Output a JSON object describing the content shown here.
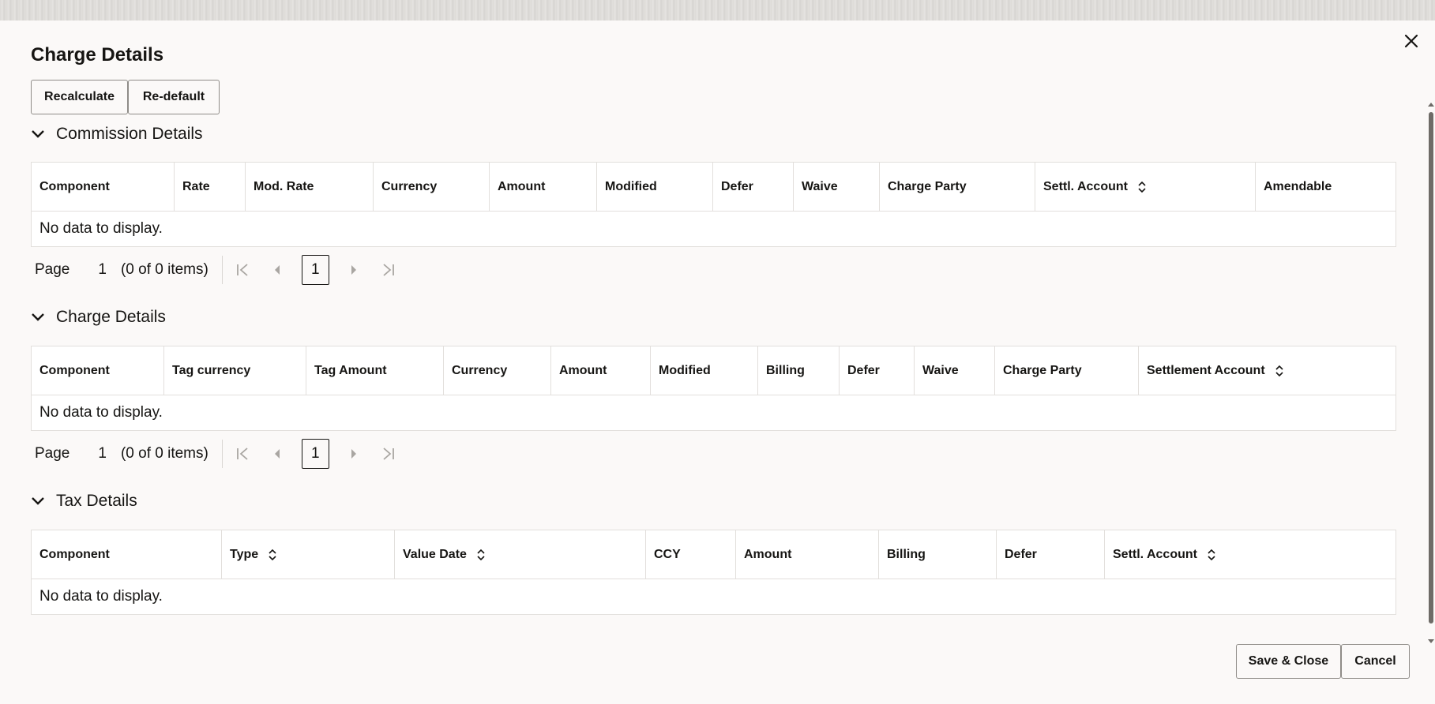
{
  "dialog": {
    "title": "Charge Details",
    "close_icon": "close-icon"
  },
  "toolbar": {
    "recalculate_label": "Recalculate",
    "redefault_label": "Re-default"
  },
  "commission": {
    "title": "Commission Details",
    "columns": [
      "Component",
      "Rate",
      "Mod. Rate",
      "Currency",
      "Amount",
      "Modified",
      "Defer",
      "Waive",
      "Charge Party",
      "Settl. Account",
      "Amendable"
    ],
    "empty_text": "No data to display.",
    "pager": {
      "page_label": "Page",
      "page_value": "1",
      "items_text": "(0 of 0 items)",
      "current_page": "1"
    }
  },
  "charge": {
    "title": "Charge Details",
    "columns": [
      "Component",
      "Tag currency",
      "Tag Amount",
      "Currency",
      "Amount",
      "Modified",
      "Billing",
      "Defer",
      "Waive",
      "Charge Party",
      "Settlement Account"
    ],
    "empty_text": "No data to display.",
    "pager": {
      "page_label": "Page",
      "page_value": "1",
      "items_text": "(0 of 0 items)",
      "current_page": "1"
    }
  },
  "tax": {
    "title": "Tax Details",
    "columns": [
      "Component",
      "Type",
      "Value Date",
      "CCY",
      "Amount",
      "Billing",
      "Defer",
      "Settl. Account"
    ],
    "empty_text": "No data to display."
  },
  "footer": {
    "save_close_label": "Save & Close",
    "cancel_label": "Cancel"
  }
}
